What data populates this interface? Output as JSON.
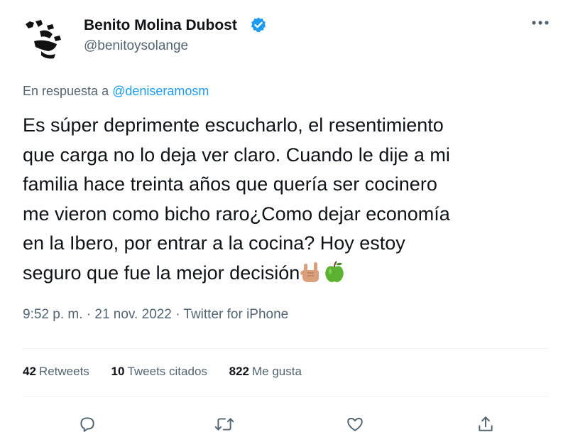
{
  "author": {
    "display_name": "Benito Molina Dubost",
    "handle": "@benitoysolange",
    "verified": true,
    "verified_color": "#1d9bf0"
  },
  "reply": {
    "prefix": "En respuesta a ",
    "mention": "@deniseramosm"
  },
  "tweet": {
    "lines": [
      "Es súper deprimente escucharlo, el resentimiento",
      "que carga no lo deja ver claro. Cuando le dije a mi",
      "familia hace treinta años que quería ser cocinero",
      "me vieron como bicho raro¿Como dejar economía",
      "en la Ibero, por entrar a la cocina? Hoy estoy",
      "seguro que fue la mejor decisión"
    ],
    "emojis": [
      "sign-of-the-horns-emoji",
      "green-apple-emoji"
    ]
  },
  "meta": {
    "time": "9:52 p. m.",
    "separator": " · ",
    "date": "21 nov. 2022",
    "source": "Twitter for iPhone"
  },
  "stats": {
    "retweets_count": "42",
    "retweets_label": "Retweets",
    "quotes_count": "10",
    "quotes_label": "Tweets citados",
    "likes_count": "822",
    "likes_label": "Me gusta"
  },
  "actions": [
    "reply-icon",
    "retweet-icon",
    "like-icon",
    "share-icon"
  ],
  "colors": {
    "text": "#0f1419",
    "secondary": "#536471",
    "link": "#1d9bf0",
    "divider": "#eff3f4"
  }
}
